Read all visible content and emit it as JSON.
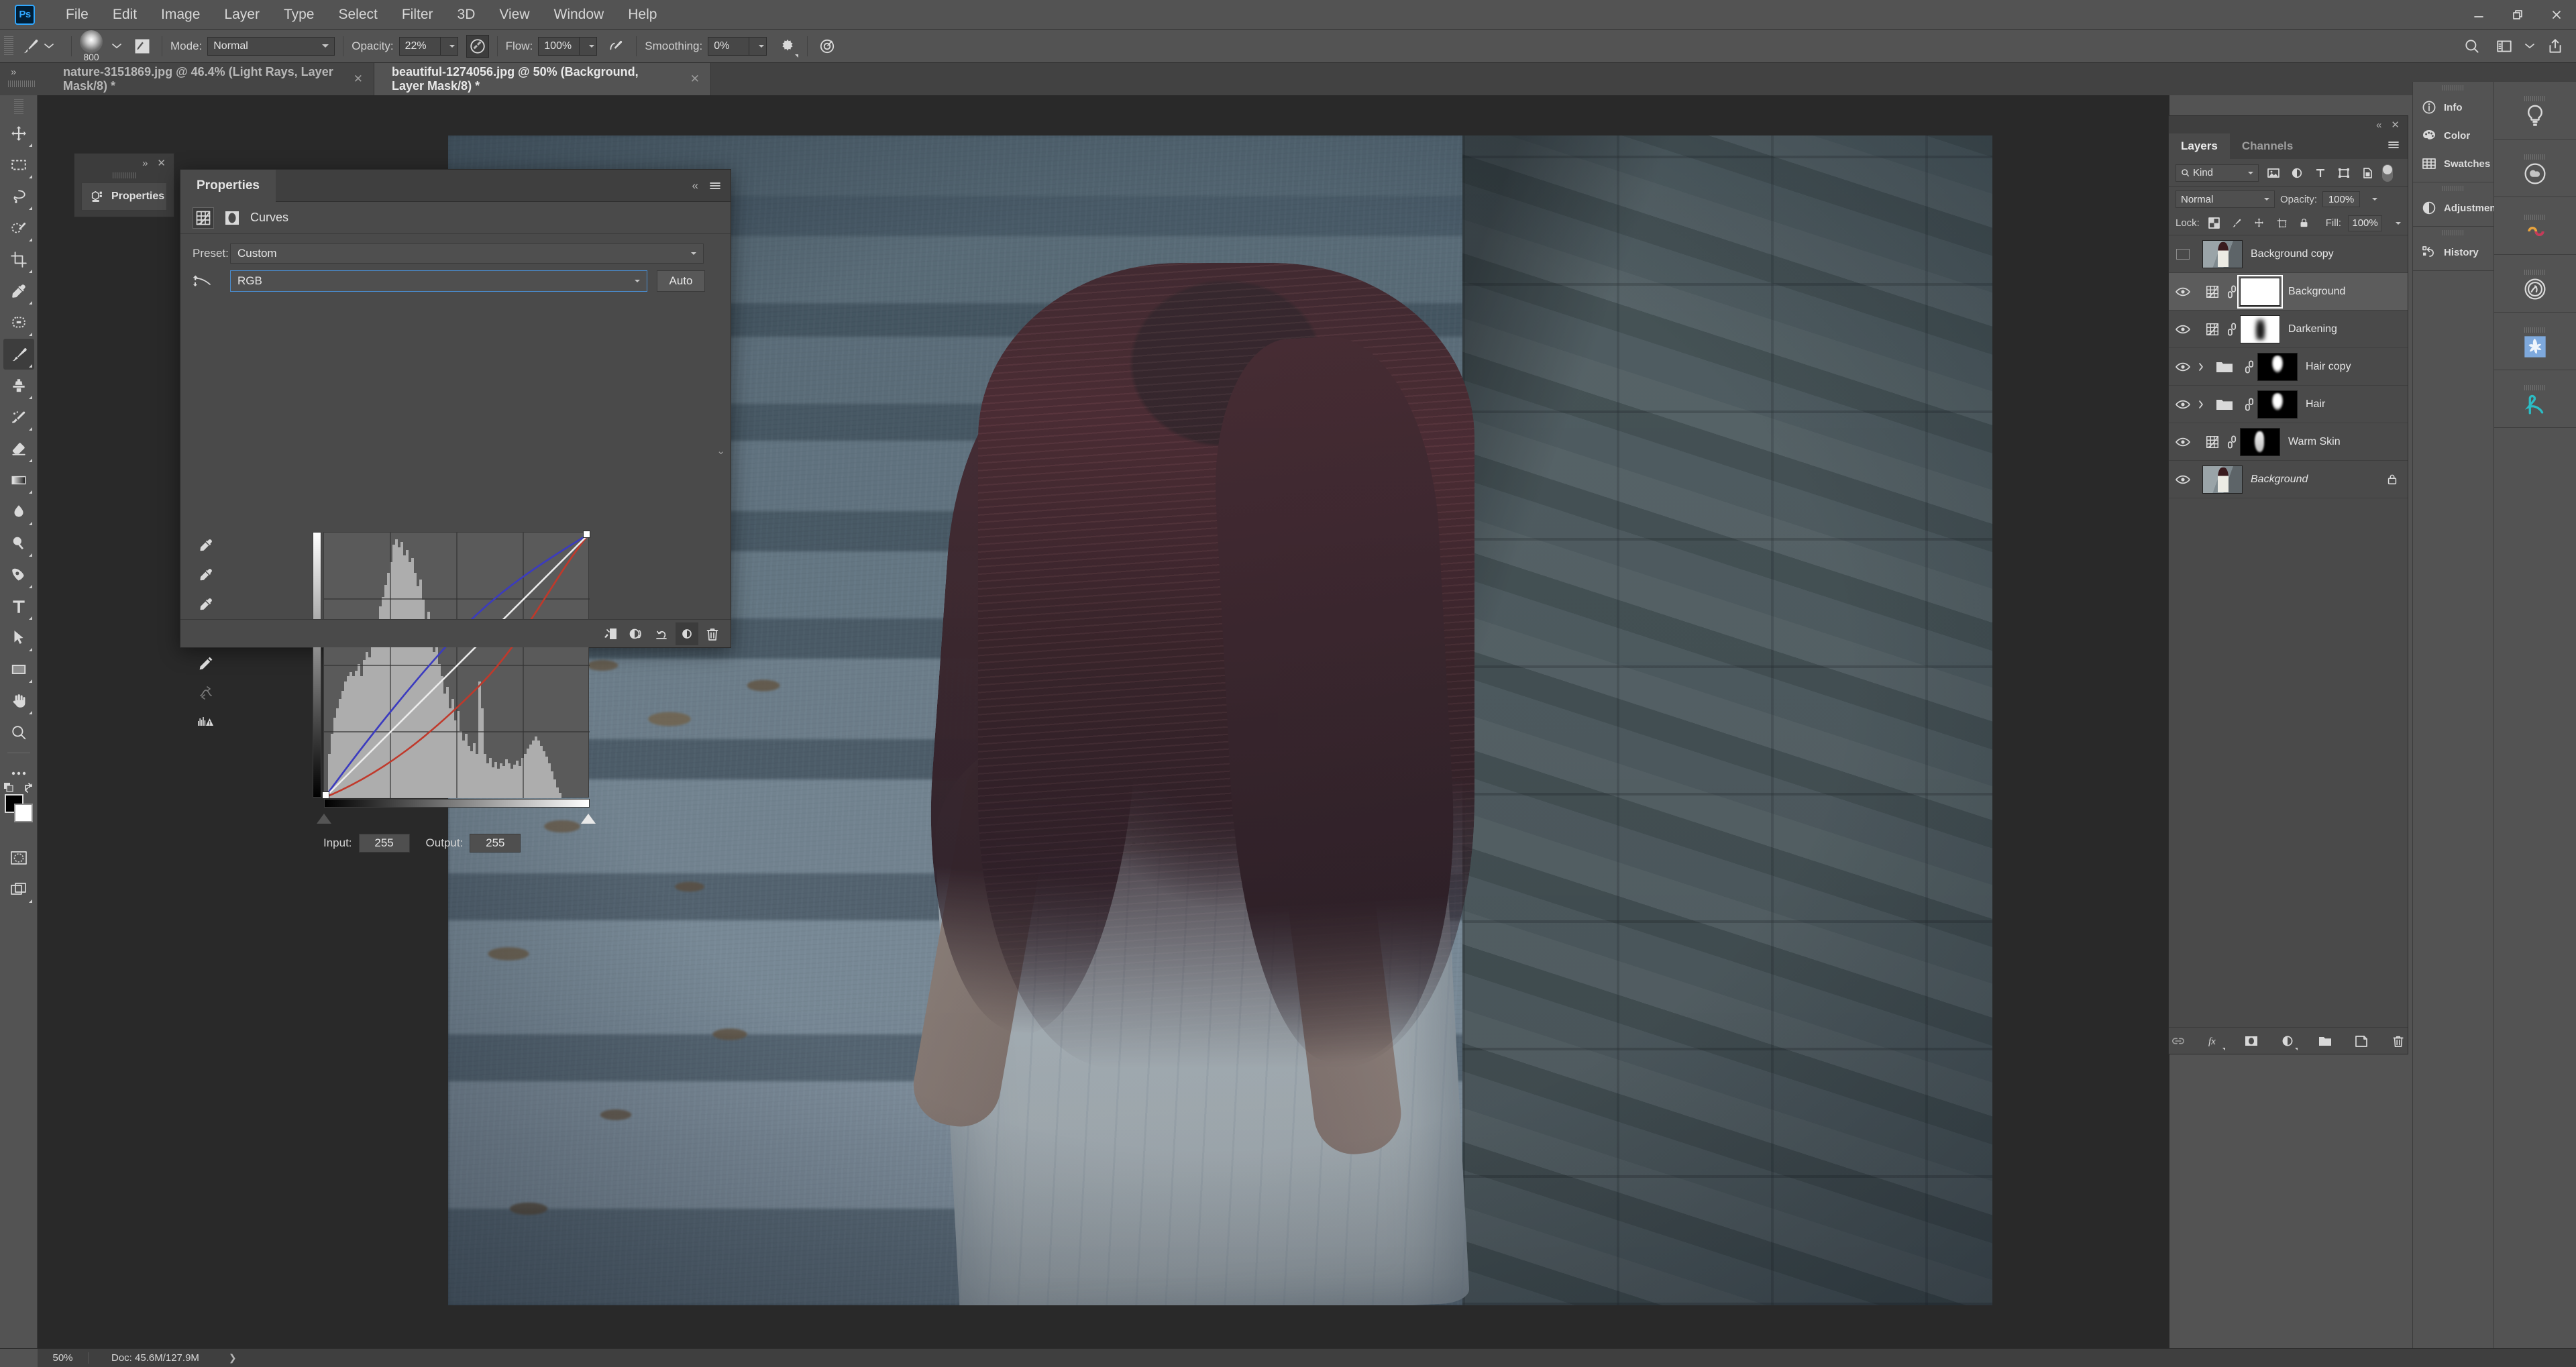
{
  "app": {
    "name": "Adobe Photoshop",
    "logo_text": "Ps",
    "accent": "#31a8ff",
    "chrome_bg": "#535353",
    "panel_bg": "#4a4a4a"
  },
  "window_controls": {
    "minimize": "—",
    "maximize": "❐",
    "close": "✕"
  },
  "menubar": {
    "items": [
      "File",
      "Edit",
      "Image",
      "Layer",
      "Type",
      "Select",
      "Filter",
      "3D",
      "View",
      "Window",
      "Help"
    ]
  },
  "options_bar": {
    "tool_icon": "brush-tool-icon",
    "brush_size": "800",
    "mode_label": "Mode:",
    "mode_value": "Normal",
    "opacity_label": "Opacity:",
    "opacity_value": "22%",
    "flow_label": "Flow:",
    "flow_value": "100%",
    "smoothing_label": "Smoothing:",
    "smoothing_value": "0%",
    "airbrush_icon": "airbrush-icon",
    "pressure_opacity_icon": "pressure-opacity-icon",
    "pressure_size_icon": "pressure-size-icon",
    "settings_icon": "gear-icon",
    "symmetry_icon": "symmetry-icon",
    "search_icon": "search-icon",
    "workspace_icon": "workspace-switcher-icon",
    "share_icon": "share-icon"
  },
  "document_tabs": [
    {
      "title": "nature-3151869.jpg @ 46.4% (Light Rays, Layer Mask/8) *",
      "active": false,
      "close": "✕"
    },
    {
      "title": "beautiful-1274056.jpg @ 50% (Background, Layer Mask/8) *",
      "active": true,
      "close": "✕"
    }
  ],
  "toolbar": {
    "tools": [
      {
        "name": "move-tool",
        "icon": "move-icon",
        "active": false
      },
      {
        "name": "marquee-tool",
        "icon": "rectangular-marquee-icon",
        "active": false
      },
      {
        "name": "lasso-tool",
        "icon": "lasso-icon",
        "active": false
      },
      {
        "name": "quick-selection-tool",
        "icon": "quick-selection-icon",
        "active": false
      },
      {
        "name": "crop-tool",
        "icon": "crop-icon",
        "active": false
      },
      {
        "name": "eyedropper-tool",
        "icon": "eyedropper-icon",
        "active": false
      },
      {
        "name": "spot-healing-tool",
        "icon": "spot-healing-icon",
        "active": false
      },
      {
        "name": "brush-tool",
        "icon": "brush-icon",
        "active": true
      },
      {
        "name": "clone-stamp-tool",
        "icon": "clone-stamp-icon",
        "active": false
      },
      {
        "name": "history-brush-tool",
        "icon": "history-brush-icon",
        "active": false
      },
      {
        "name": "eraser-tool",
        "icon": "eraser-icon",
        "active": false
      },
      {
        "name": "gradient-tool",
        "icon": "gradient-icon",
        "active": false
      },
      {
        "name": "blur-tool",
        "icon": "blur-drop-icon",
        "active": false
      },
      {
        "name": "dodge-tool",
        "icon": "dodge-icon",
        "active": false
      },
      {
        "name": "pen-tool",
        "icon": "pen-icon",
        "active": false
      },
      {
        "name": "type-tool",
        "icon": "type-t-icon",
        "active": false
      },
      {
        "name": "path-selection-tool",
        "icon": "path-arrow-icon",
        "active": false
      },
      {
        "name": "rectangle-tool",
        "icon": "rectangle-shape-icon",
        "active": false
      },
      {
        "name": "hand-tool",
        "icon": "hand-icon",
        "active": false
      },
      {
        "name": "zoom-tool",
        "icon": "magnifier-icon",
        "active": false
      },
      {
        "name": "edit-toolbar",
        "icon": "ellipsis-icon",
        "active": false
      }
    ],
    "foreground_color": "#000000",
    "background_color": "#ffffff",
    "quick_mask_icon": "quick-mask-icon",
    "screen_mode_icon": "screen-mode-icon",
    "swap_colors_icon": "swap-colors-icon",
    "default_colors_icon": "default-colors-icon"
  },
  "properties_panel": {
    "dock_tab_label": "Properties",
    "dock_collapse": "»",
    "dock_close": "✕",
    "tab_label": "Properties",
    "collapse_icon": "collapse-double-chevron-icon",
    "menu_icon": "panel-menu-icon",
    "adjustment_type": "Curves",
    "adjustment_icon": "curves-icon",
    "mask_icon": "mask-thumbnail-icon",
    "preset_label": "Preset:",
    "preset_value": "Custom",
    "channel_value": "RGB",
    "auto_button": "Auto",
    "input_label": "Input:",
    "input_value": "255",
    "output_label": "Output:",
    "output_value": "255",
    "curve_tools": [
      {
        "name": "black-point-eyedropper",
        "icon": "eyedropper-black-icon",
        "active": false
      },
      {
        "name": "gray-point-eyedropper",
        "icon": "eyedropper-gray-icon",
        "active": false
      },
      {
        "name": "white-point-eyedropper",
        "icon": "eyedropper-white-icon",
        "active": false
      },
      {
        "name": "curve-point-tool",
        "icon": "curve-point-icon",
        "active": true
      },
      {
        "name": "pencil-draw-curve-tool",
        "icon": "pencil-icon",
        "active": false
      },
      {
        "name": "smooth-curve-tool",
        "icon": "smooth-curve-icon",
        "active": false
      },
      {
        "name": "histogram-warning",
        "icon": "histogram-warning-icon",
        "active": false
      }
    ],
    "footer_buttons": [
      {
        "name": "clip-to-layer-button",
        "icon": "clip-to-layer-icon",
        "active": false
      },
      {
        "name": "toggle-previous-state-button",
        "icon": "toggle-state-icon",
        "active": false
      },
      {
        "name": "reset-adjustment-button",
        "icon": "reset-arrow-icon",
        "active": false
      },
      {
        "name": "toggle-visibility-button",
        "icon": "visibility-circle-icon",
        "active": true
      },
      {
        "name": "delete-adjustment-button",
        "icon": "trash-icon",
        "active": false
      }
    ]
  },
  "chart_data": {
    "type": "line",
    "title": "Curves — RGB channel",
    "xlabel": "Input",
    "ylabel": "Output",
    "xlim": [
      0,
      255
    ],
    "ylim": [
      0,
      255
    ],
    "grid": "4x4",
    "background_histogram": "image luminance histogram, peak in shadows/low-midtones around input 55-75",
    "series": [
      {
        "name": "RGB (composite)",
        "color": "#e8e8e8",
        "x": [
          0,
          64,
          128,
          192,
          255
        ],
        "values": [
          0,
          64,
          128,
          192,
          255
        ]
      },
      {
        "name": "Blue",
        "color": "#3b3bbf",
        "x": [
          0,
          64,
          128,
          192,
          255
        ],
        "values": [
          0,
          86,
          156,
          212,
          255
        ]
      },
      {
        "name": "Red",
        "color": "#c0392b",
        "x": [
          0,
          64,
          128,
          192,
          255
        ],
        "values": [
          0,
          40,
          92,
          158,
          255
        ]
      }
    ],
    "control_points": [
      {
        "input": 0,
        "output": 0
      },
      {
        "input": 255,
        "output": 255
      }
    ]
  },
  "layers_panel": {
    "collapse_icon": "collapse-double-chevron-icon",
    "close_icon": "close-icon",
    "tabs": [
      {
        "label": "Layers",
        "active": true
      },
      {
        "label": "Channels",
        "active": false
      }
    ],
    "menu_icon": "panel-menu-icon",
    "filter_label": "Kind",
    "filter_icon": "search-icon",
    "filter_buttons": [
      {
        "name": "filter-pixel-layers",
        "icon": "image-icon"
      },
      {
        "name": "filter-adjustment-layers",
        "icon": "half-circle-icon"
      },
      {
        "name": "filter-type-layers",
        "icon": "type-t-icon"
      },
      {
        "name": "filter-shape-layers",
        "icon": "shape-icon"
      },
      {
        "name": "filter-smart-objects",
        "icon": "smart-object-icon"
      }
    ],
    "filter_toggle": "filter-enable-toggle",
    "blend_mode": "Normal",
    "opacity_label": "Opacity:",
    "opacity_value": "100%",
    "lock_label": "Lock:",
    "lock_buttons": [
      {
        "name": "lock-transparent-pixels",
        "icon": "checkerboard-icon"
      },
      {
        "name": "lock-image-pixels",
        "icon": "brush-icon"
      },
      {
        "name": "lock-position",
        "icon": "move-arrows-icon"
      },
      {
        "name": "lock-artboard-nesting",
        "icon": "artboard-icon"
      },
      {
        "name": "lock-all",
        "icon": "lock-icon"
      }
    ],
    "fill_label": "Fill:",
    "fill_value": "100%",
    "layers": [
      {
        "name": "Background copy",
        "visible": false,
        "type": "pixel",
        "thumb": "photo",
        "selected": false,
        "locked": false,
        "italic": false,
        "group": false,
        "linked": false
      },
      {
        "name": "Background",
        "visible": true,
        "type": "adjustment",
        "thumb": "white-mask",
        "selected": true,
        "locked": false,
        "italic": false,
        "group": false,
        "linked": true
      },
      {
        "name": "Darkening",
        "visible": true,
        "type": "adjustment",
        "thumb": "dark-mask",
        "selected": false,
        "locked": false,
        "italic": false,
        "group": false,
        "linked": true
      },
      {
        "name": "Hair copy",
        "visible": true,
        "type": "group",
        "thumb": "hair-mask",
        "selected": false,
        "locked": false,
        "italic": false,
        "group": true,
        "linked": true
      },
      {
        "name": "Hair",
        "visible": true,
        "type": "group",
        "thumb": "hair-mask",
        "selected": false,
        "locked": false,
        "italic": false,
        "group": true,
        "linked": true
      },
      {
        "name": "Warm Skin",
        "visible": true,
        "type": "adjustment",
        "thumb": "skin-mask",
        "selected": false,
        "locked": false,
        "italic": false,
        "group": false,
        "linked": true
      },
      {
        "name": "Background",
        "visible": true,
        "type": "pixel",
        "thumb": "photo",
        "selected": false,
        "locked": true,
        "italic": true,
        "group": false,
        "linked": false
      }
    ],
    "footer_buttons": [
      {
        "name": "link-layers-button",
        "icon": "link-icon"
      },
      {
        "name": "layer-style-button",
        "icon": "fx-icon"
      },
      {
        "name": "add-layer-mask-button",
        "icon": "mask-icon"
      },
      {
        "name": "new-adjustment-layer-button",
        "icon": "half-circle-icon"
      },
      {
        "name": "new-group-button",
        "icon": "folder-icon"
      },
      {
        "name": "new-layer-button",
        "icon": "new-layer-icon"
      },
      {
        "name": "delete-layer-button",
        "icon": "trash-icon"
      }
    ]
  },
  "right_dock": {
    "group_one": [
      {
        "label": "Info",
        "icon": "info-circle-icon"
      },
      {
        "label": "Color",
        "icon": "color-palette-icon"
      },
      {
        "label": "Swatches",
        "icon": "swatches-grid-icon"
      }
    ],
    "group_two": [
      {
        "label": "Adjustments",
        "icon": "half-circle-icon"
      }
    ],
    "group_three": [
      {
        "label": "History",
        "icon": "history-icon"
      }
    ],
    "icon_rail": [
      {
        "name": "learn-bulb-icon",
        "color": "#d4d4d4"
      },
      {
        "name": "libraries-cloud-icon",
        "color": "#b8b8b8"
      },
      {
        "name": "adobe-color-themes-icon",
        "color": "#e8a33d"
      },
      {
        "name": "measurement-log-icon",
        "color": "#c9c9c9"
      },
      {
        "name": "stock-photo-icon",
        "color": "#6fa8dc"
      },
      {
        "name": "brand-script-icon",
        "color": "#2bbcc4"
      }
    ]
  },
  "status_bar": {
    "zoom": "50%",
    "doc_label": "Doc:",
    "doc_size": "45.6M/127.9M",
    "expand_arrow": "❯"
  }
}
